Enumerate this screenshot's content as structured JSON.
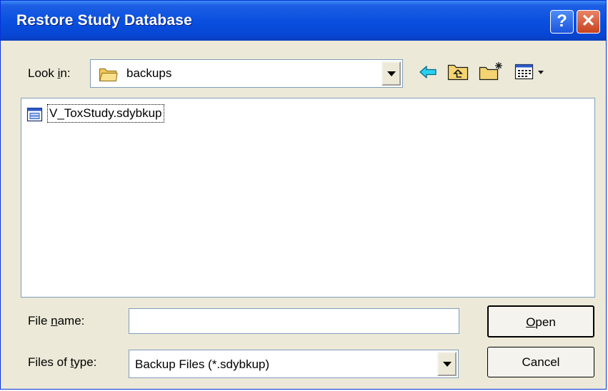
{
  "window": {
    "title": "Restore Study Database",
    "help_glyph": "?",
    "close_glyph": "✕"
  },
  "look_in": {
    "label": "Look in:",
    "accesskey": "i",
    "value": "backups",
    "icon": "folder-icon"
  },
  "toolbar": {
    "icons": [
      "back-arrow-icon",
      "up-one-level-icon",
      "new-folder-icon",
      "view-menu-icon"
    ]
  },
  "files": [
    {
      "name": "V_ToxStudy.sdybkup",
      "icon": "database-file-icon",
      "focused": true
    }
  ],
  "file_name": {
    "label": "File name:",
    "accesskey": "n",
    "value": ""
  },
  "file_type": {
    "label": "Files of type:",
    "accesskey": "t",
    "value": "Backup Files (*.sdybkup)"
  },
  "buttons": {
    "open_label": "Open",
    "open_accesskey": "O",
    "cancel_label": "Cancel"
  },
  "colors": {
    "title_blue": "#0a50e0",
    "dialog_face": "#ece9d8",
    "close_red": "#c8421e",
    "toolbar_arrow": "#00a8d8"
  }
}
